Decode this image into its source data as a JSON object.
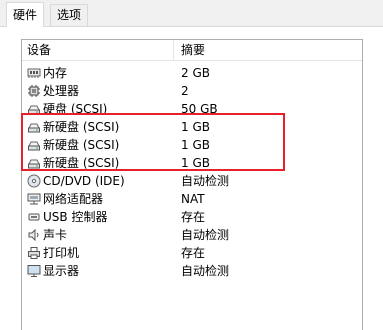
{
  "tabs": [
    {
      "label": "硬件"
    },
    {
      "label": "选项"
    }
  ],
  "table": {
    "headers": {
      "device": "设备",
      "summary": "摘要"
    },
    "rows": [
      {
        "device": "内存",
        "summary": "2 GB",
        "icon": "memory-icon"
      },
      {
        "device": "处理器",
        "summary": "2",
        "icon": "processor-icon"
      },
      {
        "device": "硬盘 (SCSI)",
        "summary": "50 GB",
        "icon": "hard-disk-icon"
      },
      {
        "device": "新硬盘 (SCSI)",
        "summary": "1 GB",
        "icon": "hard-disk-icon"
      },
      {
        "device": "新硬盘 (SCSI)",
        "summary": "1 GB",
        "icon": "hard-disk-icon"
      },
      {
        "device": "新硬盘 (SCSI)",
        "summary": "1 GB",
        "icon": "hard-disk-icon"
      },
      {
        "device": "CD/DVD (IDE)",
        "summary": "自动检测",
        "icon": "cd-dvd-icon"
      },
      {
        "device": "网络适配器",
        "summary": "NAT",
        "icon": "network-adapter-icon"
      },
      {
        "device": "USB 控制器",
        "summary": "存在",
        "icon": "usb-icon"
      },
      {
        "device": "声卡",
        "summary": "自动检测",
        "icon": "sound-card-icon"
      },
      {
        "device": "打印机",
        "summary": "存在",
        "icon": "printer-icon"
      },
      {
        "device": "显示器",
        "summary": "自动检测",
        "icon": "display-icon"
      }
    ]
  },
  "colors": {
    "highlight": "#e8202a",
    "border": "#adadad"
  }
}
